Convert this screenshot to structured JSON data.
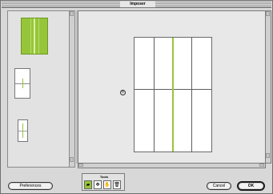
{
  "window": {
    "title": "Imposer"
  },
  "thumbnails": [
    {
      "name": "green-sheet"
    },
    {
      "name": "white-sheet-large"
    },
    {
      "name": "white-sheet-small"
    }
  ],
  "tools": {
    "label": "Tools",
    "items": [
      {
        "name": "fold-tool",
        "glyph": "▰"
      },
      {
        "name": "move-tool",
        "glyph": "✥"
      },
      {
        "name": "hand-tool",
        "glyph": "✋"
      },
      {
        "name": "trash-tool",
        "glyph": "🗑"
      }
    ]
  },
  "buttons": {
    "preferences": "Preferences",
    "cancel": "Cancel",
    "ok": "OK"
  },
  "icons": {
    "rotate": "↻"
  },
  "colors": {
    "accent": "#97c53a"
  }
}
